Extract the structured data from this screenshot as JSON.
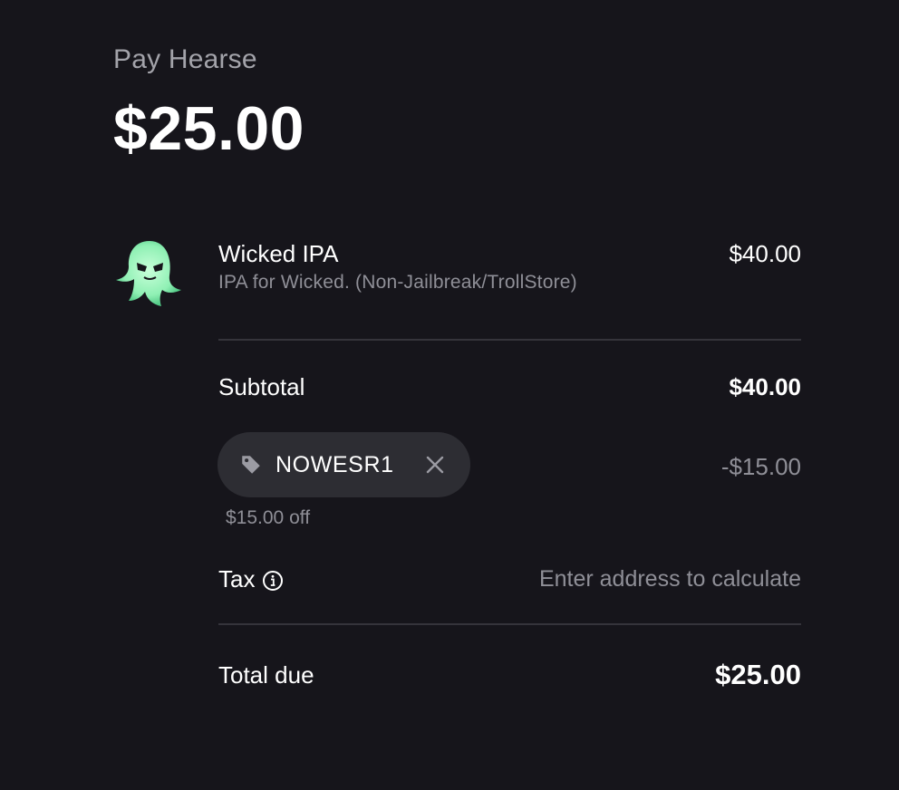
{
  "header": {
    "pay_label": "Pay Hearse",
    "amount": "$25.00"
  },
  "product": {
    "icon": "ghost-icon",
    "name": "Wicked IPA",
    "description": "IPA for Wicked. (Non-Jailbreak/TrollStore)",
    "price": "$40.00"
  },
  "summary": {
    "subtotal_label": "Subtotal",
    "subtotal_value": "$40.00",
    "promo": {
      "icon": "tag-icon",
      "code": "NOWESR1",
      "remove_icon": "close-icon",
      "discount": "-$15.00",
      "note": "$15.00 off"
    },
    "tax_label": "Tax",
    "tax_info_icon": "info-icon",
    "tax_value": "Enter address to calculate",
    "total_label": "Total due",
    "total_value": "$25.00"
  },
  "colors": {
    "background": "#16151b",
    "text": "#ffffff",
    "muted_text": "#8f8f97",
    "chip_background": "#2d2d33",
    "divider": "#35343b",
    "ghost": "#8ff0b4"
  }
}
